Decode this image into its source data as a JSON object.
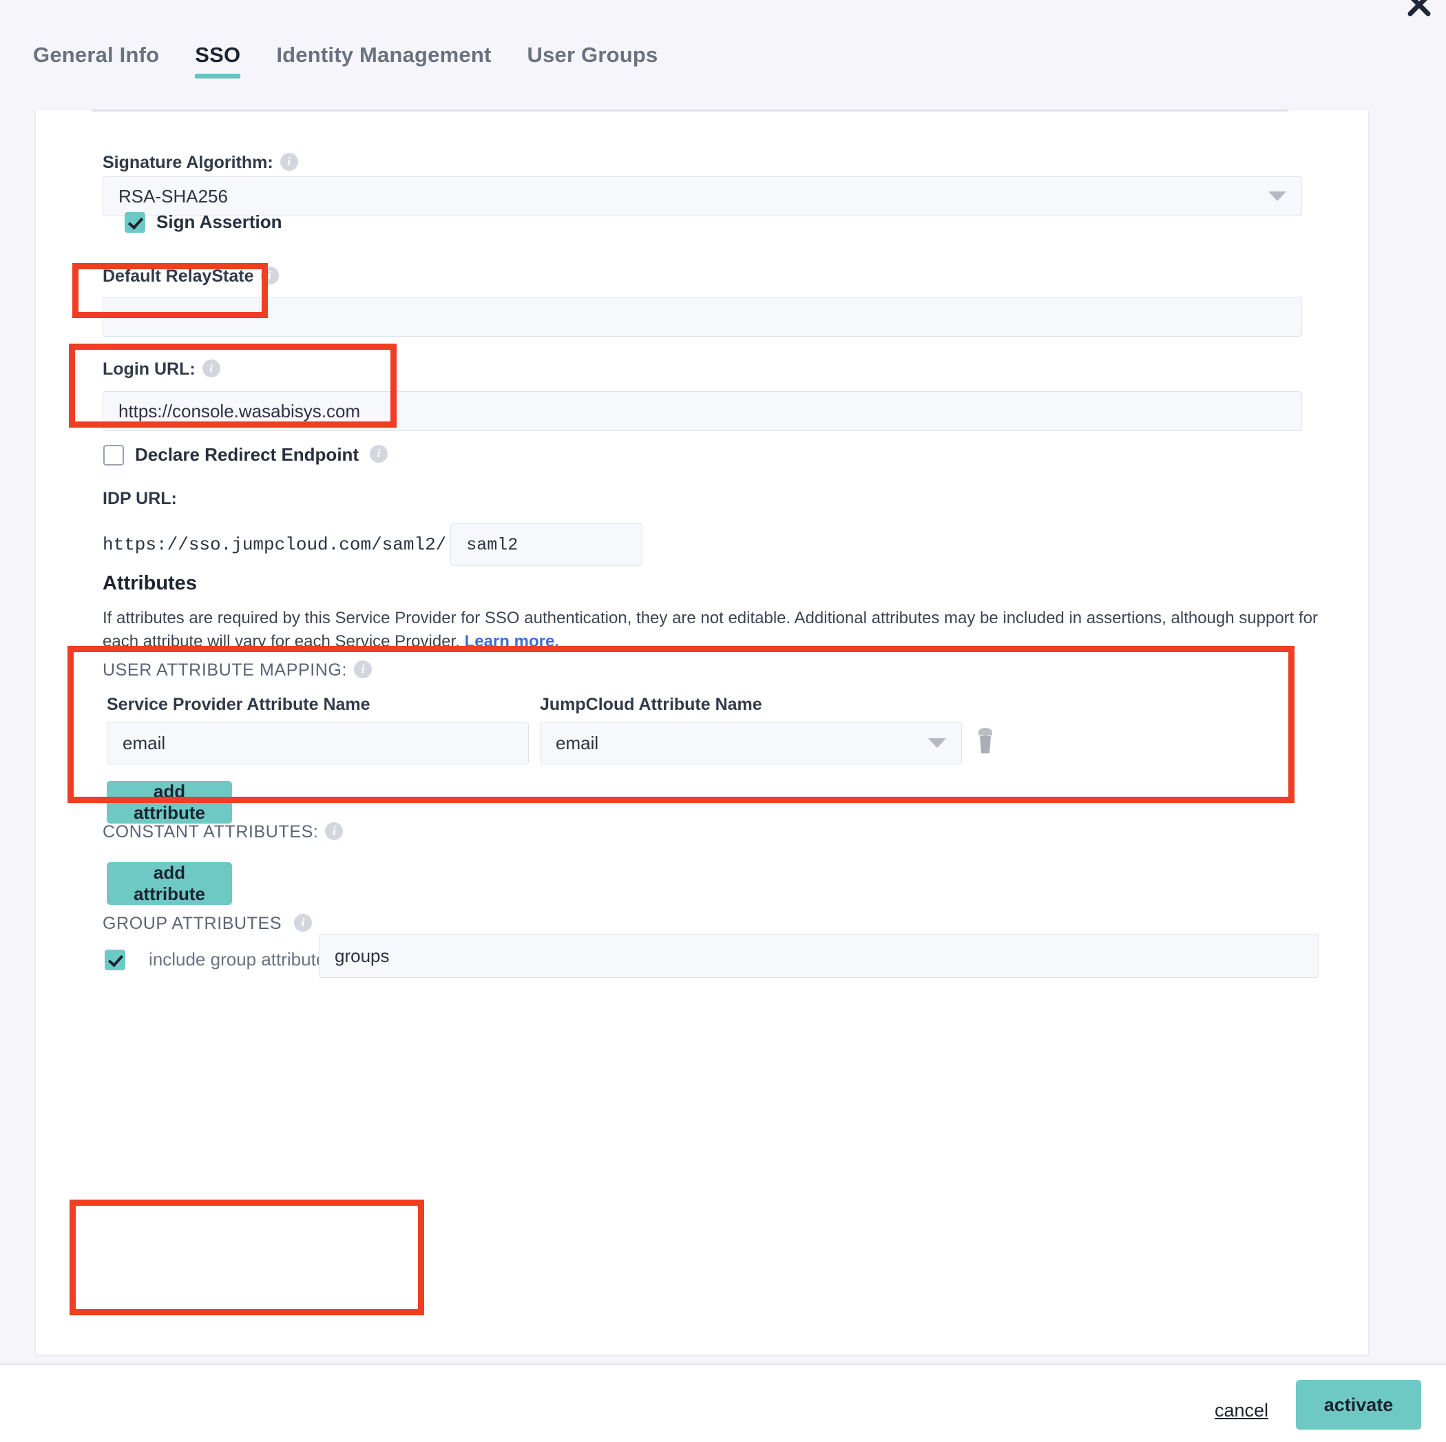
{
  "window": {
    "close_icon": "close-icon"
  },
  "tabs": [
    {
      "label": "General Info",
      "active": false
    },
    {
      "label": "SSO",
      "active": true
    },
    {
      "label": "Identity Management",
      "active": false
    },
    {
      "label": "User Groups",
      "active": false
    }
  ],
  "form": {
    "signature_algorithm": {
      "label": "Signature Algorithm:",
      "value": "RSA-SHA256"
    },
    "sign_assertion": {
      "label": "Sign Assertion",
      "checked": true
    },
    "default_relay_state": {
      "label": "Default RelayState",
      "value": "",
      "placeholder": ""
    },
    "login_url": {
      "label": "Login URL:",
      "value": "https://console.wasabisys.com"
    },
    "declare_redirect_endpoint": {
      "label": "Declare Redirect Endpoint",
      "checked": false
    },
    "idp_url": {
      "label": "IDP URL:",
      "prefix": "https://sso.jumpcloud.com/saml2/",
      "value": "saml2"
    }
  },
  "attributes": {
    "heading": "Attributes",
    "description_part1": "If attributes are required by this Service Provider for SSO authentication, they are not editable. Additional attributes may be included in assertions, although support for each attribute will vary for each Service Provider.",
    "learn_more": "Learn more.",
    "user_attribute_mapping": {
      "label": "USER ATTRIBUTE MAPPING:",
      "col_sp": "Service Provider Attribute Name",
      "col_jc": "JumpCloud Attribute Name",
      "rows": [
        {
          "sp_value": "email",
          "jc_value": "email"
        }
      ],
      "add_button": "add attribute",
      "delete_icon": "trash-icon"
    },
    "constant_attributes": {
      "label": "CONSTANT ATTRIBUTES:",
      "add_button": "add attribute"
    },
    "group_attributes": {
      "label": "GROUP ATTRIBUTES",
      "include_label": "include group attribute",
      "include_checked": true,
      "value": "groups"
    }
  },
  "footer": {
    "cancel_label": "cancel",
    "activate_label": "activate"
  },
  "colors": {
    "accent_teal": "#6ec9c5",
    "highlight_red": "#ef3e23",
    "link_blue": "#3a6fd8",
    "page_bg": "#f5f5fa"
  }
}
